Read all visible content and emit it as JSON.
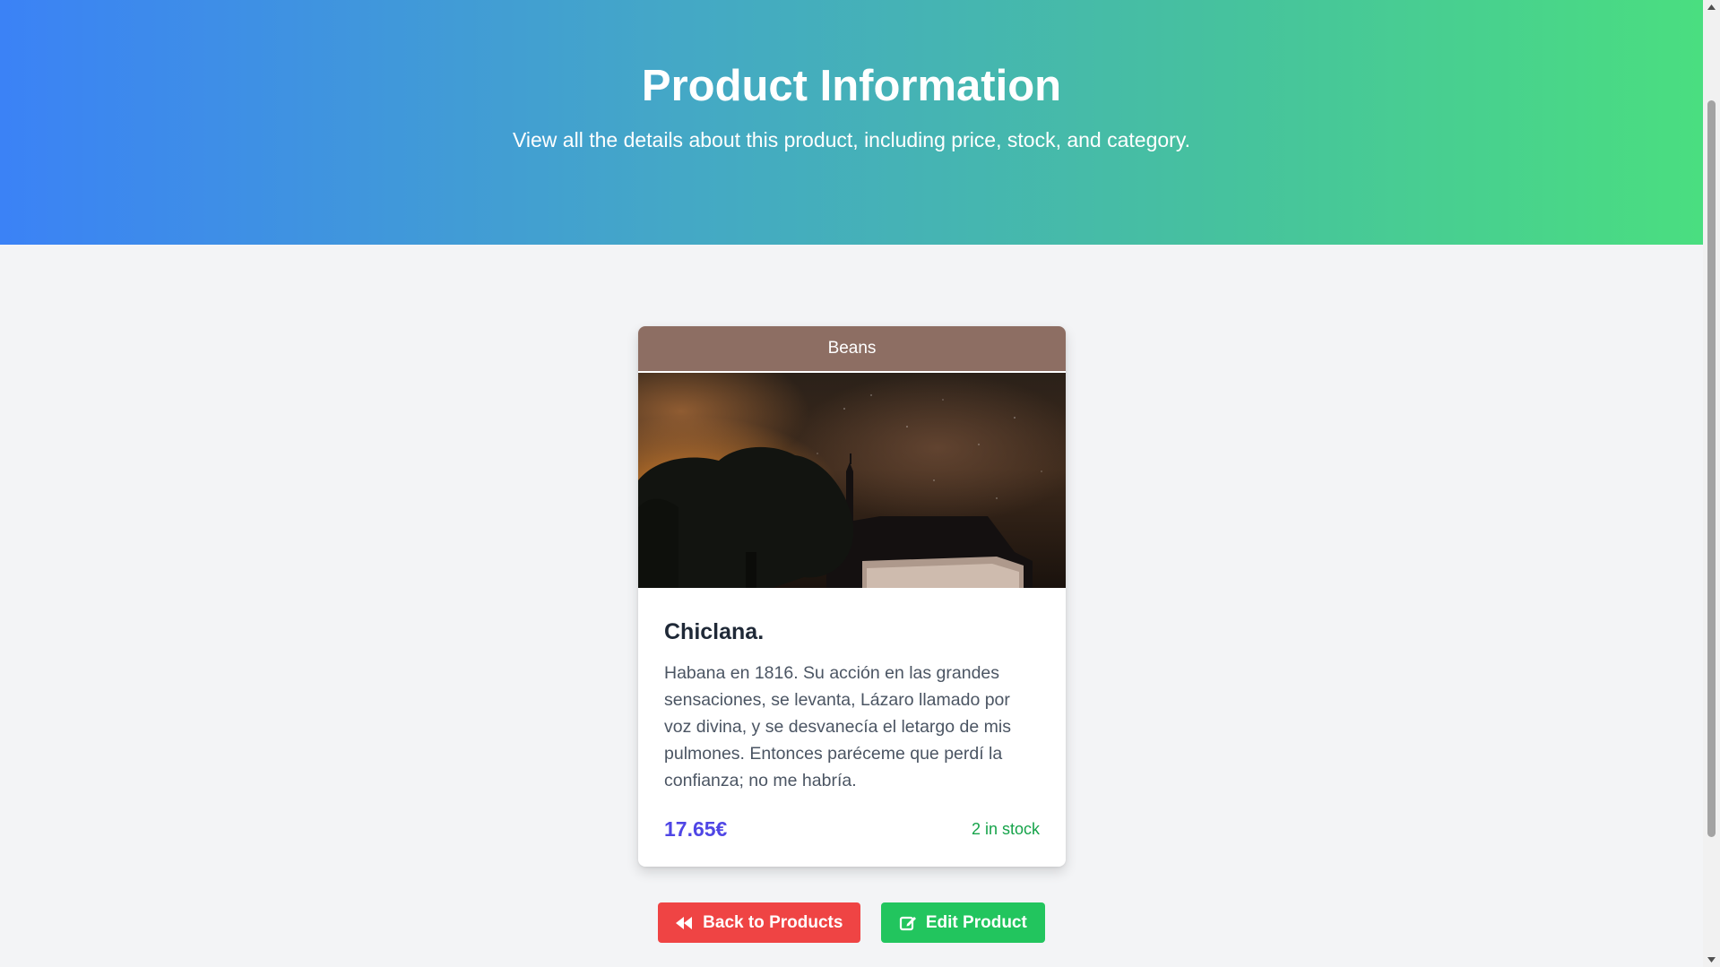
{
  "header": {
    "title": "Product Information",
    "subtitle": "View all the details about this product, including price, stock, and category."
  },
  "product": {
    "category": "Beans",
    "image_alt": "Night sky over a church silhouette and large tree",
    "name": "Chiclana.",
    "description": "Habana en 1816. Su acción en las grandes sensaciones, se levanta, Lázaro llamado por voz divina, y se desvanecía el letargo de mis pulmones. Entonces paréceme que perdí la confianza; no me habría.",
    "price": "17.65€",
    "stock": "2 in stock"
  },
  "actions": {
    "back_label": "Back to Products",
    "back_icon": "backward-icon",
    "edit_label": "Edit Product",
    "edit_icon": "edit-icon"
  },
  "colors": {
    "gradient_start": "#3b82f6",
    "gradient_end": "#4ade80",
    "category_bg": "#8d6e63",
    "price": "#4f46e5",
    "stock": "#16a34a",
    "back_button": "#ef4444",
    "edit_button": "#22c55e"
  }
}
